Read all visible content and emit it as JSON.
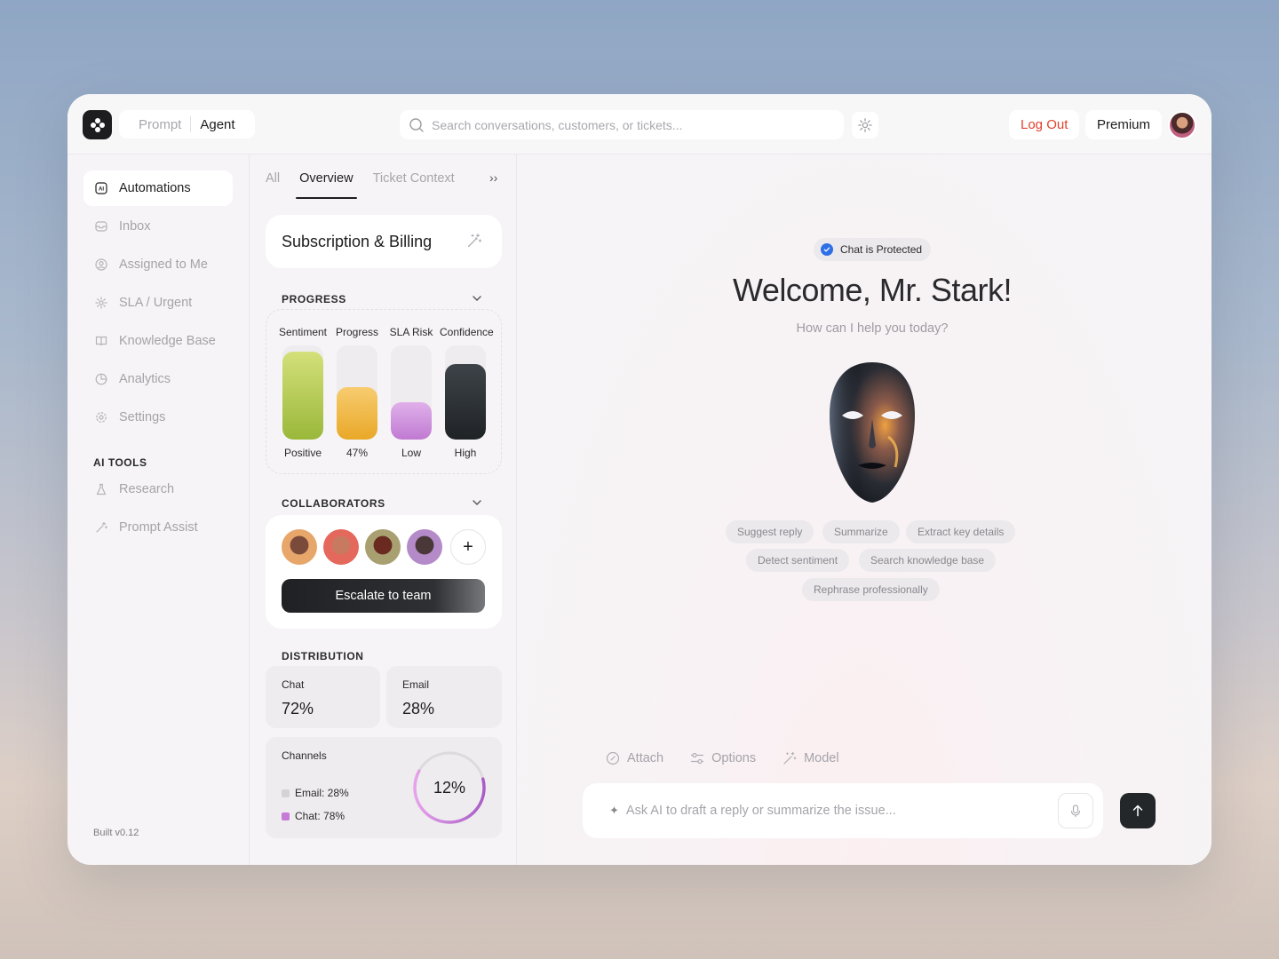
{
  "header": {
    "modes": [
      "Prompt",
      "Agent"
    ],
    "active_mode": "Agent",
    "search_placeholder": "Search conversations, customers, or tickets...",
    "logout_label": "Log Out",
    "premium_label": "Premium"
  },
  "sidebar": {
    "items": [
      {
        "label": "Automations",
        "icon": "ai-icon",
        "active": true
      },
      {
        "label": "Inbox",
        "icon": "inbox-icon"
      },
      {
        "label": "Assigned to Me",
        "icon": "user-circle-icon"
      },
      {
        "label": "SLA / Urgent",
        "icon": "sun-icon"
      },
      {
        "label": "Knowledge Base",
        "icon": "book-icon"
      },
      {
        "label": "Analytics",
        "icon": "pie-icon"
      },
      {
        "label": "Settings",
        "icon": "gear-icon"
      }
    ],
    "ai_tools_label": "AI TOOLS",
    "ai_tools": [
      {
        "label": "Research",
        "icon": "flask-icon"
      },
      {
        "label": "Prompt Assist",
        "icon": "magic-wand-icon"
      }
    ],
    "version": "Built v0.12"
  },
  "panel": {
    "tabs": [
      "All",
      "Overview",
      "Ticket Context"
    ],
    "active_tab": "Overview",
    "more_label": "››",
    "topic": "Subscription & Billing",
    "progress_label": "PROGRESS",
    "progress": [
      {
        "caption": "Sentiment",
        "value": "Positive",
        "level": 0.93,
        "color": "#a8c24a"
      },
      {
        "caption": "Progress",
        "value": "47%",
        "level": 0.56,
        "color": "#efb53f"
      },
      {
        "caption": "SLA Risk",
        "value": "Low",
        "level": 0.4,
        "color": "#c98ad6"
      },
      {
        "caption": "Confidence",
        "value": "High",
        "level": 0.8,
        "color": "#2b2f33"
      }
    ],
    "collaborators_label": "COLLABORATORS",
    "escalate_label": "Escalate to team",
    "add_label": "+",
    "distribution_label": "DISTRIBUTION",
    "distribution": [
      {
        "label": "Chat",
        "value": "72%"
      },
      {
        "label": "Email",
        "value": "28%"
      }
    ],
    "channels": {
      "label": "Channels",
      "legend": [
        {
          "label": "Email: 28%",
          "color": "#d5d3d7"
        },
        {
          "label": "Chat: 78%",
          "color": "#c77ad8"
        }
      ],
      "donut_value": "12%",
      "donut_fraction": 0.62
    }
  },
  "main": {
    "badge": "Chat is Protected",
    "welcome": "Welcome, Mr. Stark!",
    "subtitle": "How can I help you today?",
    "suggestions": [
      "Suggest reply",
      "Summarize",
      "Extract key details",
      "Detect sentiment",
      "Search knowledge base",
      "Rephrase professionally"
    ],
    "actions": [
      {
        "label": "Attach",
        "icon": "paperclip-icon"
      },
      {
        "label": "Options",
        "icon": "sliders-icon"
      },
      {
        "label": "Model",
        "icon": "magic-wand-icon"
      }
    ],
    "composer_placeholder": "Ask AI to draft a reply or summarize the issue..."
  }
}
